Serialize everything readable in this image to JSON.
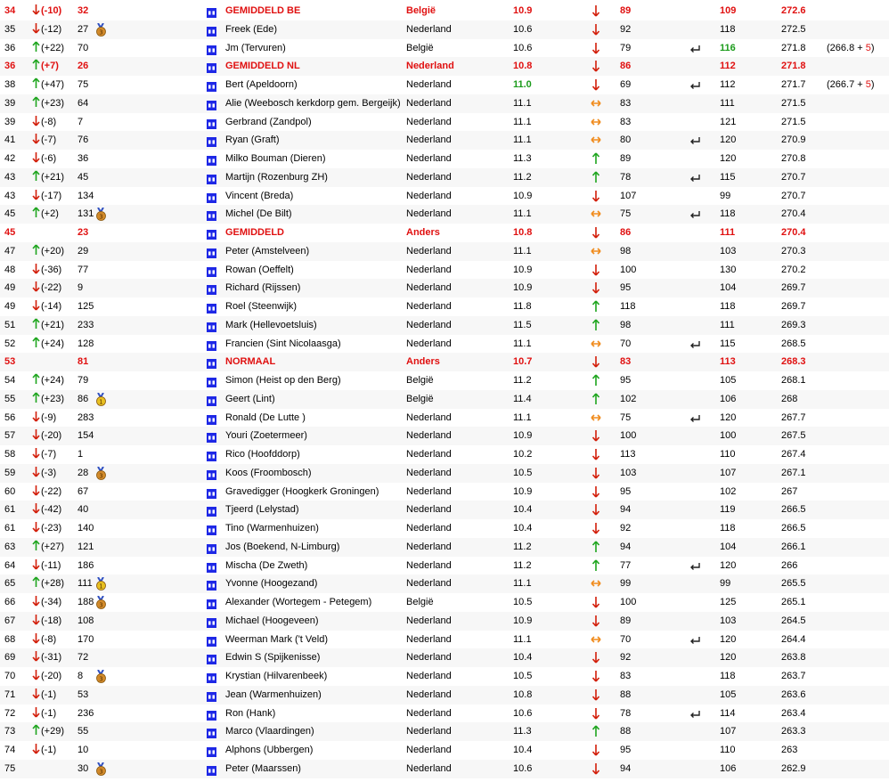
{
  "colors": {
    "up": "#1ea51e",
    "down": "#d21e0a",
    "side": "#f08c1e",
    "average": "#e01010",
    "flag": "#1e28e6"
  },
  "rows": [
    {
      "rank": "34",
      "trend_dir": "down",
      "trend": "(-10)",
      "prev": "32",
      "medal": "",
      "name": "GEMIDDELD BE",
      "country": "België",
      "val1": "10.9",
      "dir": "down",
      "val2": "89",
      "ret": false,
      "val3": "109",
      "total": "272.6",
      "extra": "",
      "extra_plus": "",
      "avg": true
    },
    {
      "rank": "35",
      "trend_dir": "down",
      "trend": "(-12)",
      "prev": "27",
      "medal": "medal-3-icon",
      "name": "Freek (Ede)",
      "country": "Nederland",
      "val1": "10.6",
      "dir": "down",
      "val2": "92",
      "ret": false,
      "val3": "118",
      "total": "272.5",
      "extra": "",
      "extra_plus": ""
    },
    {
      "rank": "36",
      "trend_dir": "up",
      "trend": "(+22)",
      "prev": "70",
      "medal": "",
      "name": "Jm (Tervuren)",
      "country": "België",
      "val1": "10.6",
      "dir": "down",
      "val2": "79",
      "ret": true,
      "val3": "116",
      "val3_green": true,
      "total": "271.8",
      "extra": "(266.8 + ",
      "extra_plus": "5",
      "extra_close": ")"
    },
    {
      "rank": "36",
      "trend_dir": "up",
      "trend": "(+7)",
      "prev": "26",
      "medal": "",
      "name": "GEMIDDELD NL",
      "country": "Nederland",
      "val1": "10.8",
      "dir": "down",
      "val2": "86",
      "ret": false,
      "val3": "112",
      "total": "271.8",
      "extra": "",
      "extra_plus": "",
      "avg": true
    },
    {
      "rank": "38",
      "trend_dir": "up",
      "trend": "(+47)",
      "prev": "75",
      "medal": "",
      "name": "Bert (Apeldoorn)",
      "country": "Nederland",
      "val1": "11.0",
      "val1_green": true,
      "dir": "down",
      "val2": "69",
      "ret": true,
      "val3": "112",
      "total": "271.7",
      "extra": "(266.7 + ",
      "extra_plus": "5",
      "extra_close": ")"
    },
    {
      "rank": "39",
      "trend_dir": "up",
      "trend": "(+23)",
      "prev": "64",
      "medal": "",
      "name": "Alie (Weebosch kerkdorp gem. Bergeijk)",
      "country": "Nederland",
      "val1": "11.1",
      "dir": "side",
      "val2": "83",
      "ret": false,
      "val3": "111",
      "total": "271.5",
      "extra": "",
      "extra_plus": ""
    },
    {
      "rank": "39",
      "trend_dir": "down",
      "trend": "(-8)",
      "prev": "7",
      "medal": "",
      "name": "Gerbrand (Zandpol)",
      "country": "Nederland",
      "val1": "11.1",
      "dir": "side",
      "val2": "83",
      "ret": false,
      "val3": "121",
      "total": "271.5",
      "extra": "",
      "extra_plus": ""
    },
    {
      "rank": "41",
      "trend_dir": "down",
      "trend": "(-7)",
      "prev": "76",
      "medal": "",
      "name": "Ryan (Graft)",
      "country": "Nederland",
      "val1": "11.1",
      "dir": "side",
      "val2": "80",
      "ret": true,
      "val3": "120",
      "total": "270.9",
      "extra": "",
      "extra_plus": ""
    },
    {
      "rank": "42",
      "trend_dir": "down",
      "trend": "(-6)",
      "prev": "36",
      "medal": "",
      "name": "Milko Bouman (Dieren)",
      "country": "Nederland",
      "val1": "11.3",
      "dir": "up",
      "val2": "89",
      "ret": false,
      "val3": "120",
      "total": "270.8",
      "extra": "",
      "extra_plus": ""
    },
    {
      "rank": "43",
      "trend_dir": "up",
      "trend": "(+21)",
      "prev": "45",
      "medal": "",
      "name": "Martijn (Rozenburg ZH)",
      "country": "Nederland",
      "val1": "11.2",
      "dir": "up",
      "val2": "78",
      "ret": true,
      "val3": "115",
      "total": "270.7",
      "extra": "",
      "extra_plus": ""
    },
    {
      "rank": "43",
      "trend_dir": "down",
      "trend": "(-17)",
      "prev": "134",
      "medal": "",
      "name": "Vincent (Breda)",
      "country": "Nederland",
      "val1": "10.9",
      "dir": "down",
      "val2": "107",
      "ret": false,
      "val3": "99",
      "total": "270.7",
      "extra": "",
      "extra_plus": ""
    },
    {
      "rank": "45",
      "trend_dir": "up",
      "trend": "(+2)",
      "prev": "131",
      "medal": "medal-3-icon",
      "name": "Michel (De Bilt)",
      "country": "Nederland",
      "val1": "11.1",
      "dir": "side",
      "val2": "75",
      "ret": true,
      "val3": "118",
      "total": "270.4",
      "extra": "",
      "extra_plus": ""
    },
    {
      "rank": "45",
      "trend_dir": "",
      "trend": "",
      "prev": "23",
      "medal": "",
      "name": "GEMIDDELD",
      "country": "Anders",
      "val1": "10.8",
      "dir": "down",
      "val2": "86",
      "ret": false,
      "val3": "111",
      "total": "270.4",
      "extra": "",
      "extra_plus": "",
      "avg": true
    },
    {
      "rank": "47",
      "trend_dir": "up",
      "trend": "(+20)",
      "prev": "29",
      "medal": "",
      "name": "Peter (Amstelveen)",
      "country": "Nederland",
      "val1": "11.1",
      "dir": "side",
      "val2": "98",
      "ret": false,
      "val3": "103",
      "total": "270.3",
      "extra": "",
      "extra_plus": ""
    },
    {
      "rank": "48",
      "trend_dir": "down",
      "trend": "(-36)",
      "prev": "77",
      "medal": "",
      "name": "Rowan (Oeffelt)",
      "country": "Nederland",
      "val1": "10.9",
      "dir": "down",
      "val2": "100",
      "ret": false,
      "val3": "130",
      "total": "270.2",
      "extra": "",
      "extra_plus": ""
    },
    {
      "rank": "49",
      "trend_dir": "down",
      "trend": "(-22)",
      "prev": "9",
      "medal": "",
      "name": "Richard (Rijssen)",
      "country": "Nederland",
      "val1": "10.9",
      "dir": "down",
      "val2": "95",
      "ret": false,
      "val3": "104",
      "total": "269.7",
      "extra": "",
      "extra_plus": ""
    },
    {
      "rank": "49",
      "trend_dir": "down",
      "trend": "(-14)",
      "prev": "125",
      "medal": "",
      "name": "Roel (Steenwijk)",
      "country": "Nederland",
      "val1": "11.8",
      "dir": "up",
      "val2": "118",
      "ret": false,
      "val3": "118",
      "total": "269.7",
      "extra": "",
      "extra_plus": ""
    },
    {
      "rank": "51",
      "trend_dir": "up",
      "trend": "(+21)",
      "prev": "233",
      "medal": "",
      "name": "Mark (Hellevoetsluis)",
      "country": "Nederland",
      "val1": "11.5",
      "dir": "up",
      "val2": "98",
      "ret": false,
      "val3": "111",
      "total": "269.3",
      "extra": "",
      "extra_plus": ""
    },
    {
      "rank": "52",
      "trend_dir": "up",
      "trend": "(+24)",
      "prev": "128",
      "medal": "",
      "name": "Francien (Sint Nicolaasga)",
      "country": "Nederland",
      "val1": "11.1",
      "dir": "side",
      "val2": "70",
      "ret": true,
      "val3": "115",
      "total": "268.5",
      "extra": "",
      "extra_plus": ""
    },
    {
      "rank": "53",
      "trend_dir": "",
      "trend": "",
      "prev": "81",
      "medal": "",
      "name": "NORMAAL",
      "country": "Anders",
      "val1": "10.7",
      "dir": "down",
      "val2": "83",
      "ret": false,
      "val3": "113",
      "total": "268.3",
      "extra": "",
      "extra_plus": "",
      "avg": true
    },
    {
      "rank": "54",
      "trend_dir": "up",
      "trend": "(+24)",
      "prev": "79",
      "medal": "",
      "name": "Simon (Heist op den Berg)",
      "country": "België",
      "val1": "11.2",
      "dir": "up",
      "val2": "95",
      "ret": false,
      "val3": "105",
      "total": "268.1",
      "extra": "",
      "extra_plus": ""
    },
    {
      "rank": "55",
      "trend_dir": "up",
      "trend": "(+23)",
      "prev": "86",
      "medal": "medal-1-icon",
      "name": "Geert (Lint)",
      "country": "België",
      "val1": "11.4",
      "dir": "up",
      "val2": "102",
      "ret": false,
      "val3": "106",
      "total": "268",
      "extra": "",
      "extra_plus": ""
    },
    {
      "rank": "56",
      "trend_dir": "down",
      "trend": "(-9)",
      "prev": "283",
      "medal": "",
      "name": "Ronald (De Lutte )",
      "country": "Nederland",
      "val1": "11.1",
      "dir": "side",
      "val2": "75",
      "ret": true,
      "val3": "120",
      "total": "267.7",
      "extra": "",
      "extra_plus": ""
    },
    {
      "rank": "57",
      "trend_dir": "down",
      "trend": "(-20)",
      "prev": "154",
      "medal": "",
      "name": "Youri (Zoetermeer)",
      "country": "Nederland",
      "val1": "10.9",
      "dir": "down",
      "val2": "100",
      "ret": false,
      "val3": "100",
      "total": "267.5",
      "extra": "",
      "extra_plus": ""
    },
    {
      "rank": "58",
      "trend_dir": "down",
      "trend": "(-7)",
      "prev": "1",
      "medal": "",
      "name": "Rico (Hoofddorp)",
      "country": "Nederland",
      "val1": "10.2",
      "dir": "down",
      "val2": "113",
      "ret": false,
      "val3": "110",
      "total": "267.4",
      "extra": "",
      "extra_plus": ""
    },
    {
      "rank": "59",
      "trend_dir": "down",
      "trend": "(-3)",
      "prev": "28",
      "medal": "medal-3-icon",
      "name": "Koos (Froombosch)",
      "country": "Nederland",
      "val1": "10.5",
      "dir": "down",
      "val2": "103",
      "ret": false,
      "val3": "107",
      "total": "267.1",
      "extra": "",
      "extra_plus": ""
    },
    {
      "rank": "60",
      "trend_dir": "down",
      "trend": "(-22)",
      "prev": "67",
      "medal": "",
      "name": "Gravedigger (Hoogkerk Groningen)",
      "country": "Nederland",
      "val1": "10.9",
      "dir": "down",
      "val2": "95",
      "ret": false,
      "val3": "102",
      "total": "267",
      "extra": "",
      "extra_plus": ""
    },
    {
      "rank": "61",
      "trend_dir": "down",
      "trend": "(-42)",
      "prev": "40",
      "medal": "",
      "name": "Tjeerd (Lelystad)",
      "country": "Nederland",
      "val1": "10.4",
      "dir": "down",
      "val2": "94",
      "ret": false,
      "val3": "119",
      "total": "266.5",
      "extra": "",
      "extra_plus": ""
    },
    {
      "rank": "61",
      "trend_dir": "down",
      "trend": "(-23)",
      "prev": "140",
      "medal": "",
      "name": "Tino (Warmenhuizen)",
      "country": "Nederland",
      "val1": "10.4",
      "dir": "down",
      "val2": "92",
      "ret": false,
      "val3": "118",
      "total": "266.5",
      "extra": "",
      "extra_plus": ""
    },
    {
      "rank": "63",
      "trend_dir": "up",
      "trend": "(+27)",
      "prev": "121",
      "medal": "",
      "name": "Jos (Boekend, N-Limburg)",
      "country": "Nederland",
      "val1": "11.2",
      "dir": "up",
      "val2": "94",
      "ret": false,
      "val3": "104",
      "total": "266.1",
      "extra": "",
      "extra_plus": ""
    },
    {
      "rank": "64",
      "trend_dir": "down",
      "trend": "(-11)",
      "prev": "186",
      "medal": "",
      "name": "Mischa (De Zweth)",
      "country": "Nederland",
      "val1": "11.2",
      "dir": "up",
      "val2": "77",
      "ret": true,
      "val3": "120",
      "total": "266",
      "extra": "",
      "extra_plus": ""
    },
    {
      "rank": "65",
      "trend_dir": "up",
      "trend": "(+28)",
      "prev": "111",
      "medal": "medal-1-icon",
      "name": "Yvonne (Hoogezand)",
      "country": "Nederland",
      "val1": "11.1",
      "dir": "side",
      "val2": "99",
      "ret": false,
      "val3": "99",
      "total": "265.5",
      "extra": "",
      "extra_plus": ""
    },
    {
      "rank": "66",
      "trend_dir": "down",
      "trend": "(-34)",
      "prev": "188",
      "medal": "medal-3-icon",
      "name": "Alexander (Wortegem - Petegem)",
      "country": "België",
      "val1": "10.5",
      "dir": "down",
      "val2": "100",
      "ret": false,
      "val3": "125",
      "total": "265.1",
      "extra": "",
      "extra_plus": ""
    },
    {
      "rank": "67",
      "trend_dir": "down",
      "trend": "(-18)",
      "prev": "108",
      "medal": "",
      "name": "Michael (Hoogeveen)",
      "country": "Nederland",
      "val1": "10.9",
      "dir": "down",
      "val2": "89",
      "ret": false,
      "val3": "103",
      "total": "264.5",
      "extra": "",
      "extra_plus": ""
    },
    {
      "rank": "68",
      "trend_dir": "down",
      "trend": "(-8)",
      "prev": "170",
      "medal": "",
      "name": "Weerman Mark ('t Veld)",
      "country": "Nederland",
      "val1": "11.1",
      "dir": "side",
      "val2": "70",
      "ret": true,
      "val3": "120",
      "total": "264.4",
      "extra": "",
      "extra_plus": ""
    },
    {
      "rank": "69",
      "trend_dir": "down",
      "trend": "(-31)",
      "prev": "72",
      "medal": "",
      "name": "Edwin S (Spijkenisse)",
      "country": "Nederland",
      "val1": "10.4",
      "dir": "down",
      "val2": "92",
      "ret": false,
      "val3": "120",
      "total": "263.8",
      "extra": "",
      "extra_plus": ""
    },
    {
      "rank": "70",
      "trend_dir": "down",
      "trend": "(-20)",
      "prev": "8",
      "medal": "medal-3-icon",
      "name": "Krystian (Hilvarenbeek)",
      "country": "Nederland",
      "val1": "10.5",
      "dir": "down",
      "val2": "83",
      "ret": false,
      "val3": "118",
      "total": "263.7",
      "extra": "",
      "extra_plus": ""
    },
    {
      "rank": "71",
      "trend_dir": "down",
      "trend": "(-1)",
      "prev": "53",
      "medal": "",
      "name": "Jean (Warmenhuizen)",
      "country": "Nederland",
      "val1": "10.8",
      "dir": "down",
      "val2": "88",
      "ret": false,
      "val3": "105",
      "total": "263.6",
      "extra": "",
      "extra_plus": ""
    },
    {
      "rank": "72",
      "trend_dir": "down",
      "trend": "(-1)",
      "prev": "236",
      "medal": "",
      "name": "Ron (Hank)",
      "country": "Nederland",
      "val1": "10.6",
      "dir": "down",
      "val2": "78",
      "ret": true,
      "val3": "114",
      "total": "263.4",
      "extra": "",
      "extra_plus": ""
    },
    {
      "rank": "73",
      "trend_dir": "up",
      "trend": "(+29)",
      "prev": "55",
      "medal": "",
      "name": "Marco (Vlaardingen)",
      "country": "Nederland",
      "val1": "11.3",
      "dir": "up",
      "val2": "88",
      "ret": false,
      "val3": "107",
      "total": "263.3",
      "extra": "",
      "extra_plus": ""
    },
    {
      "rank": "74",
      "trend_dir": "down",
      "trend": "(-1)",
      "prev": "10",
      "medal": "",
      "name": "Alphons (Ubbergen)",
      "country": "Nederland",
      "val1": "10.4",
      "dir": "down",
      "val2": "95",
      "ret": false,
      "val3": "110",
      "total": "263",
      "extra": "",
      "extra_plus": ""
    },
    {
      "rank": "75",
      "trend_dir": "",
      "trend": "",
      "prev": "30",
      "medal": "medal-3-icon",
      "name": "Peter (Maarssen)",
      "country": "Nederland",
      "val1": "10.6",
      "dir": "down",
      "val2": "94",
      "ret": false,
      "val3": "106",
      "total": "262.9",
      "extra": "",
      "extra_plus": ""
    }
  ]
}
